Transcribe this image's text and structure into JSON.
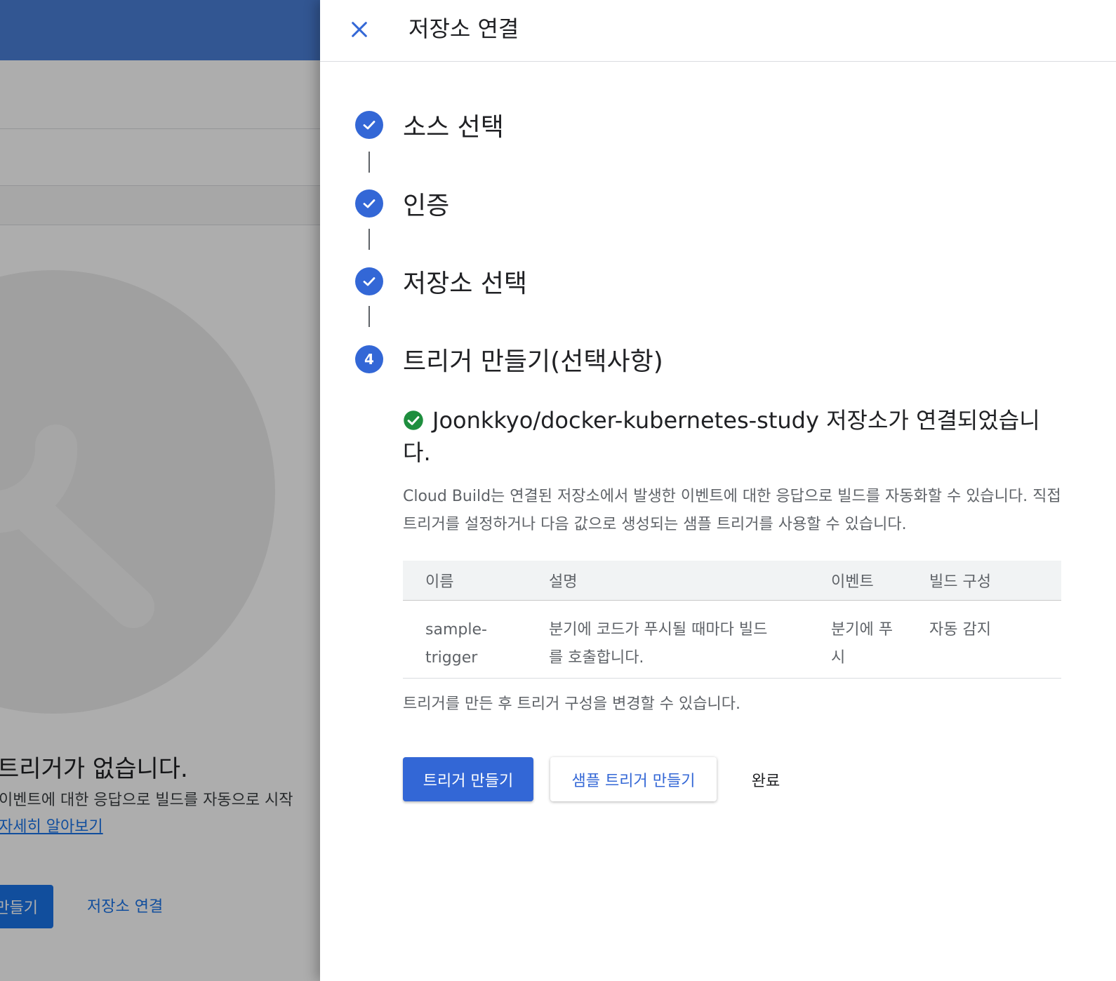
{
  "background": {
    "empty_title": "트리거가 없습니다.",
    "empty_description": "이벤트에 대한 응답으로 빌드를 자동으로 시작",
    "learn_more_link": "자세히 알아보기",
    "create_button_partial": "만들기",
    "connect_repo_link": "저장소 연결"
  },
  "panel": {
    "title": "저장소 연결",
    "close_icon": "close-icon",
    "steps": [
      {
        "label": "소스 선택",
        "status": "done"
      },
      {
        "label": "인증",
        "status": "done"
      },
      {
        "label": "저장소 선택",
        "status": "done"
      },
      {
        "label": "트리거 만들기(선택사항)",
        "status": "current",
        "number": "4"
      }
    ],
    "success_message": "Joonkkyo/docker-kubernetes-study 저장소가 연결되었습니다.",
    "info_text": "Cloud Build는 연결된 저장소에서 발생한 이벤트에 대한 응답으로 빌드를 자동화할 수 있습니다. 직접 트리거를 설정하거나 다음 값으로 생성되는 샘플 트리거를 사용할 수 있습니다.",
    "table": {
      "headers": [
        "이름",
        "설명",
        "이벤트",
        "빌드 구성"
      ],
      "rows": [
        [
          "sample-trigger",
          "분기에 코드가 푸시될 때마다 빌드를 호출합니다.",
          "분기에 푸시",
          "자동 감지"
        ]
      ]
    },
    "after_text": "트리거를 만든 후 트리거 구성을 변경할 수 있습니다.",
    "buttons": {
      "create_trigger": "트리거 만들기",
      "create_sample_trigger": "샘플 트리거 만들기",
      "done": "완료"
    }
  },
  "colors": {
    "primary": "#3367d6",
    "success": "#1e8e3e",
    "scrim": "rgba(0,0,0,0.32)"
  }
}
